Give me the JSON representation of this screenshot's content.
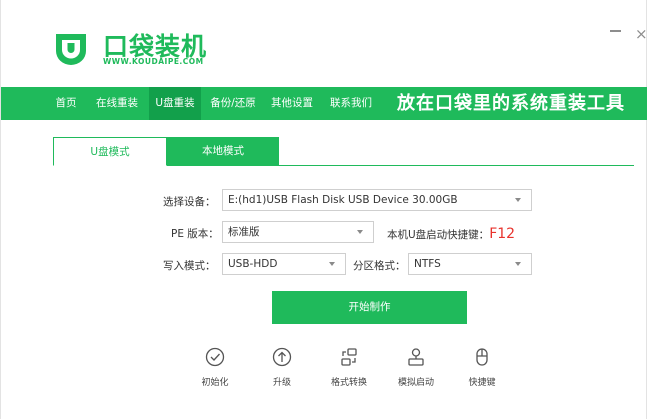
{
  "header": {
    "title": "口袋装机",
    "subtitle": "WWW.KOUDAIPE.COM",
    "minimize_label": "",
    "close_label": "×"
  },
  "nav": {
    "items": [
      {
        "label": "首页"
      },
      {
        "label": "在线重装"
      },
      {
        "label": "U盘重装",
        "active": true
      },
      {
        "label": "备份/还原"
      },
      {
        "label": "其他设置"
      },
      {
        "label": "联系我们"
      }
    ],
    "slogan": "放在口袋里的系统重装工具"
  },
  "tabs": [
    {
      "label": "U盘模式",
      "active": true
    },
    {
      "label": "本地模式",
      "active": false
    }
  ],
  "form": {
    "device_label": "选择设备：",
    "device_value": "E:(hd1)USB Flash Disk USB Device 30.00GB",
    "pe_label": "PE 版本：",
    "pe_value": "标准版",
    "hotkey_label": "本机U盘启动快捷键：",
    "hotkey_value": "F12",
    "write_label": "写入模式：",
    "write_value": "USB-HDD",
    "partition_label": "分区格式：",
    "partition_value": "NTFS"
  },
  "start_button": "开始制作",
  "tools": [
    {
      "label": "初始化",
      "icon": "check-circle-icon"
    },
    {
      "label": "升级",
      "icon": "upgrade-icon"
    },
    {
      "label": "格式转换",
      "icon": "convert-icon"
    },
    {
      "label": "模拟启动",
      "icon": "simulate-boot-icon"
    },
    {
      "label": "快捷键",
      "icon": "mouse-icon"
    }
  ],
  "colors": {
    "brand": "#1fba5b",
    "nav_active": "#12a04b",
    "hotkey": "#e8322c"
  }
}
